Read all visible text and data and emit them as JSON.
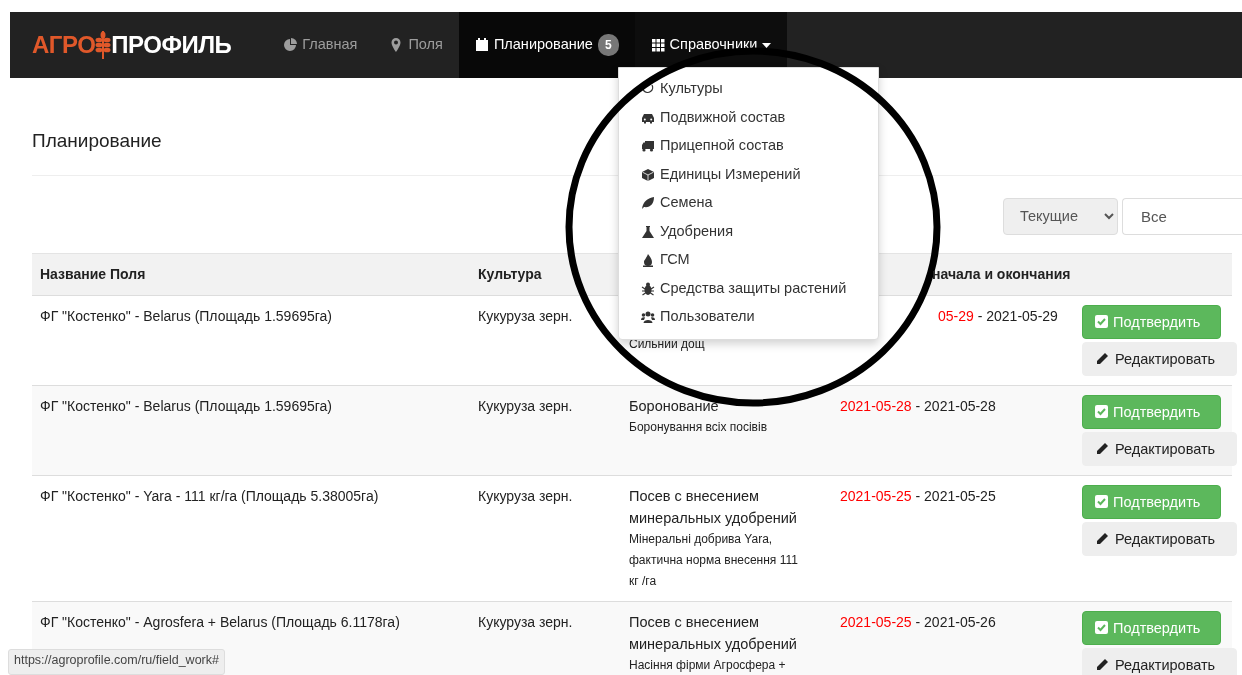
{
  "navbar": {
    "logo": {
      "part_1": "АГРО",
      "part_2": "ПРОФИЛЬ"
    },
    "items": [
      {
        "label": "Главная",
        "selected": false,
        "expanded": false
      },
      {
        "label": "Поля",
        "selected": false,
        "expanded": false
      },
      {
        "label": "Планирование",
        "selected": true,
        "expanded": false,
        "badge": "5"
      },
      {
        "label": "Справочники",
        "selected": false,
        "expanded": true
      }
    ]
  },
  "dropdown": {
    "items": [
      {
        "label": "Культуры"
      },
      {
        "label": "Подвижной состав"
      },
      {
        "label": "Прицепной состав"
      },
      {
        "label": "Единицы Измерений"
      },
      {
        "label": "Семена"
      },
      {
        "label": "Удобрения"
      },
      {
        "label": "ГСМ"
      },
      {
        "label": "Средства защиты растений"
      },
      {
        "label": "Пользователи"
      }
    ]
  },
  "page_title": "Планирование",
  "filters": [
    {
      "kind": "select",
      "value": "Текущие"
    },
    {
      "kind": "input",
      "value": "Все"
    }
  ],
  "table": {
    "header": {
      "field": "Название Поля",
      "crop": "Культура",
      "dates": "начала и окончания"
    },
    "rows": [
      {
        "field": "ФГ \"Костенко\" - Belarus (Площадь 1.59695га)",
        "crop": "Кукуруза зерн.",
        "note": "Сильний дощ",
        "start": "05-29",
        "start_overdue": true,
        "separator": "-",
        "end": "2021-05-29",
        "confirm": "Подтвердить",
        "edit": "Редактировать"
      },
      {
        "field": "ФГ \"Костенко\" - Belarus (Площадь 1.59695га)",
        "crop": "Кукуруза зерн.",
        "operation": "Боронование",
        "note": "Боронування всіх посівів",
        "start": "2021-05-28",
        "start_overdue": true,
        "separator": "-",
        "end": "2021-05-28",
        "confirm": "Подтвердить",
        "edit": "Редактировать"
      },
      {
        "field": "ФГ \"Костенко\" - Yara - 111 кг/га (Площадь 5.38005га)",
        "crop": "Кукуруза зерн.",
        "operation": "Посев с внесением минеральных удобрений",
        "note": "Мінеральні добрива Yara, фактична норма внесення 111 кг /га",
        "start": "2021-05-25",
        "start_overdue": true,
        "separator": "-",
        "end": "2021-05-25",
        "confirm": "Подтвердить",
        "edit": "Редактировать"
      },
      {
        "field": "ФГ \"Костенко\" - Agrosfera + Belarus (Площадь 6.1178га)",
        "crop": "Кукуруза зерн.",
        "operation": "Посев с внесением минеральных удобрений",
        "note": "Насіння фірми Агросфера +",
        "start": "2021-05-25",
        "start_overdue": true,
        "separator": "-",
        "end": "2021-05-26",
        "confirm": "Подтвердить",
        "edit": "Редактировать"
      }
    ]
  },
  "status_bar": "https://agroprofile.com/ru/field_work#"
}
